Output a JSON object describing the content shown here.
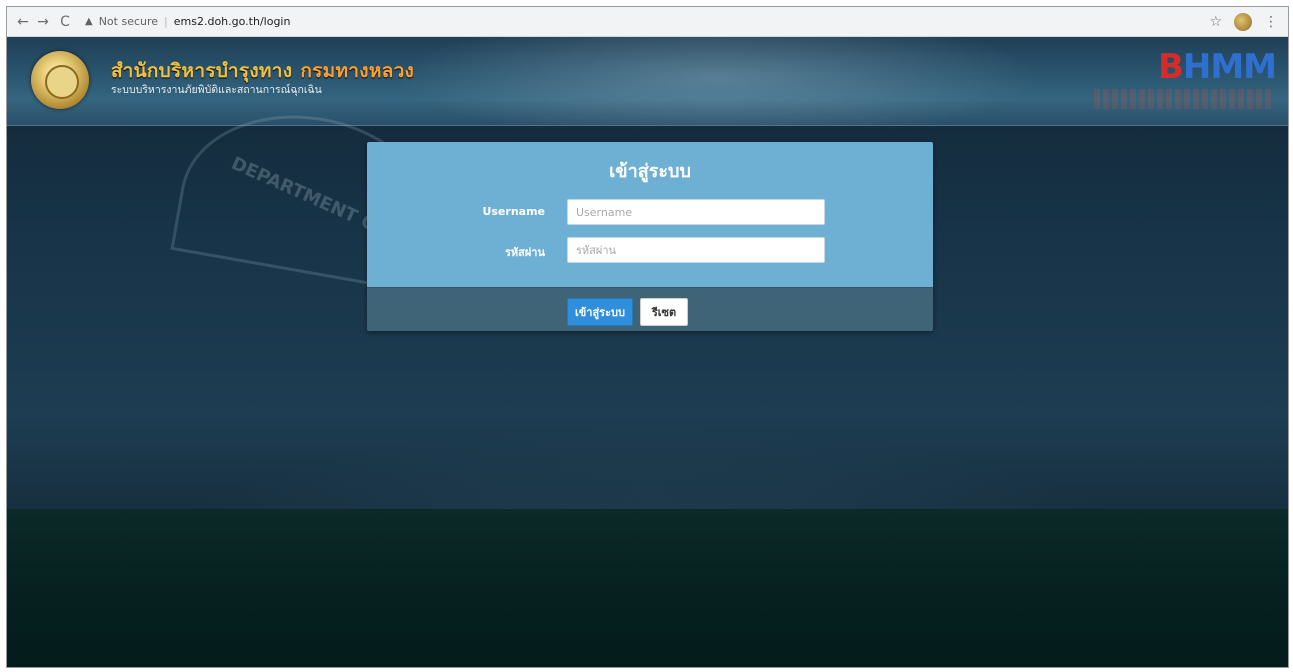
{
  "browser": {
    "back_icon": "←",
    "forward_icon": "→",
    "reload_icon": "C",
    "security_warning": "Not secure",
    "url": "ems2.doh.go.th/login",
    "bookmark_icon": "☆",
    "menu_icon": "⋮"
  },
  "header": {
    "org_title_part1": "สำนักบริหารบำรุงทาง",
    "org_title_part2": "กรมทางหลวง",
    "org_subtitle": "ระบบบริหารงานภัยพิบัติและสถานการณ์ฉุกเฉิน",
    "logo_text_part1": "B",
    "logo_text_part2": "HMM",
    "watermark_text": "DEPARTMENT OF HI"
  },
  "login": {
    "title": "เข้าสู่ระบบ",
    "username_label": "Username",
    "username_placeholder": "Username",
    "username_value": "",
    "password_label": "รหัสผ่าน",
    "password_placeholder": "รหัสผ่าน",
    "password_value": "",
    "login_button": "เข้าสู่ระบบ",
    "reset_button": "รีเซต"
  },
  "colors": {
    "panel_body": "#6eb0d3",
    "panel_footer": "#3f6478",
    "login_button": "#2f8fdc",
    "title_gold": "#f0c040",
    "title_orange": "#ff9f2f"
  }
}
